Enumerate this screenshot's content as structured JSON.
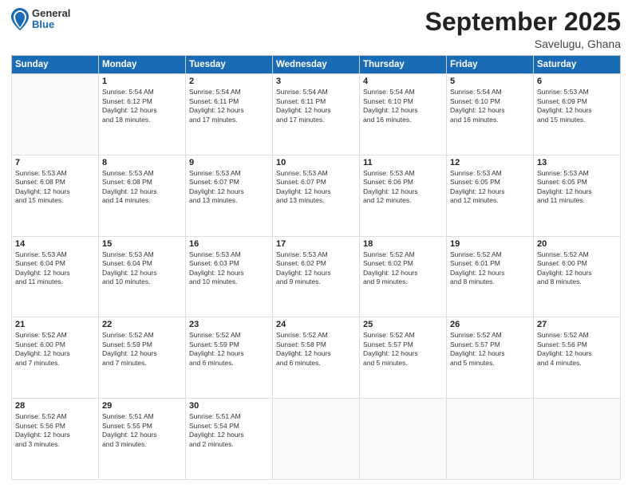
{
  "header": {
    "logo_general": "General",
    "logo_blue": "Blue",
    "month_title": "September 2025",
    "location": "Savelugu, Ghana"
  },
  "weekdays": [
    "Sunday",
    "Monday",
    "Tuesday",
    "Wednesday",
    "Thursday",
    "Friday",
    "Saturday"
  ],
  "weeks": [
    [
      {
        "day": "",
        "info": ""
      },
      {
        "day": "1",
        "info": "Sunrise: 5:54 AM\nSunset: 6:12 PM\nDaylight: 12 hours\nand 18 minutes."
      },
      {
        "day": "2",
        "info": "Sunrise: 5:54 AM\nSunset: 6:11 PM\nDaylight: 12 hours\nand 17 minutes."
      },
      {
        "day": "3",
        "info": "Sunrise: 5:54 AM\nSunset: 6:11 PM\nDaylight: 12 hours\nand 17 minutes."
      },
      {
        "day": "4",
        "info": "Sunrise: 5:54 AM\nSunset: 6:10 PM\nDaylight: 12 hours\nand 16 minutes."
      },
      {
        "day": "5",
        "info": "Sunrise: 5:54 AM\nSunset: 6:10 PM\nDaylight: 12 hours\nand 16 minutes."
      },
      {
        "day": "6",
        "info": "Sunrise: 5:53 AM\nSunset: 6:09 PM\nDaylight: 12 hours\nand 15 minutes."
      }
    ],
    [
      {
        "day": "7",
        "info": "Sunrise: 5:53 AM\nSunset: 6:08 PM\nDaylight: 12 hours\nand 15 minutes."
      },
      {
        "day": "8",
        "info": "Sunrise: 5:53 AM\nSunset: 6:08 PM\nDaylight: 12 hours\nand 14 minutes."
      },
      {
        "day": "9",
        "info": "Sunrise: 5:53 AM\nSunset: 6:07 PM\nDaylight: 12 hours\nand 13 minutes."
      },
      {
        "day": "10",
        "info": "Sunrise: 5:53 AM\nSunset: 6:07 PM\nDaylight: 12 hours\nand 13 minutes."
      },
      {
        "day": "11",
        "info": "Sunrise: 5:53 AM\nSunset: 6:06 PM\nDaylight: 12 hours\nand 12 minutes."
      },
      {
        "day": "12",
        "info": "Sunrise: 5:53 AM\nSunset: 6:05 PM\nDaylight: 12 hours\nand 12 minutes."
      },
      {
        "day": "13",
        "info": "Sunrise: 5:53 AM\nSunset: 6:05 PM\nDaylight: 12 hours\nand 11 minutes."
      }
    ],
    [
      {
        "day": "14",
        "info": "Sunrise: 5:53 AM\nSunset: 6:04 PM\nDaylight: 12 hours\nand 11 minutes."
      },
      {
        "day": "15",
        "info": "Sunrise: 5:53 AM\nSunset: 6:04 PM\nDaylight: 12 hours\nand 10 minutes."
      },
      {
        "day": "16",
        "info": "Sunrise: 5:53 AM\nSunset: 6:03 PM\nDaylight: 12 hours\nand 10 minutes."
      },
      {
        "day": "17",
        "info": "Sunrise: 5:53 AM\nSunset: 6:02 PM\nDaylight: 12 hours\nand 9 minutes."
      },
      {
        "day": "18",
        "info": "Sunrise: 5:52 AM\nSunset: 6:02 PM\nDaylight: 12 hours\nand 9 minutes."
      },
      {
        "day": "19",
        "info": "Sunrise: 5:52 AM\nSunset: 6:01 PM\nDaylight: 12 hours\nand 8 minutes."
      },
      {
        "day": "20",
        "info": "Sunrise: 5:52 AM\nSunset: 6:00 PM\nDaylight: 12 hours\nand 8 minutes."
      }
    ],
    [
      {
        "day": "21",
        "info": "Sunrise: 5:52 AM\nSunset: 6:00 PM\nDaylight: 12 hours\nand 7 minutes."
      },
      {
        "day": "22",
        "info": "Sunrise: 5:52 AM\nSunset: 5:59 PM\nDaylight: 12 hours\nand 7 minutes."
      },
      {
        "day": "23",
        "info": "Sunrise: 5:52 AM\nSunset: 5:59 PM\nDaylight: 12 hours\nand 6 minutes."
      },
      {
        "day": "24",
        "info": "Sunrise: 5:52 AM\nSunset: 5:58 PM\nDaylight: 12 hours\nand 6 minutes."
      },
      {
        "day": "25",
        "info": "Sunrise: 5:52 AM\nSunset: 5:57 PM\nDaylight: 12 hours\nand 5 minutes."
      },
      {
        "day": "26",
        "info": "Sunrise: 5:52 AM\nSunset: 5:57 PM\nDaylight: 12 hours\nand 5 minutes."
      },
      {
        "day": "27",
        "info": "Sunrise: 5:52 AM\nSunset: 5:56 PM\nDaylight: 12 hours\nand 4 minutes."
      }
    ],
    [
      {
        "day": "28",
        "info": "Sunrise: 5:52 AM\nSunset: 5:56 PM\nDaylight: 12 hours\nand 3 minutes."
      },
      {
        "day": "29",
        "info": "Sunrise: 5:51 AM\nSunset: 5:55 PM\nDaylight: 12 hours\nand 3 minutes."
      },
      {
        "day": "30",
        "info": "Sunrise: 5:51 AM\nSunset: 5:54 PM\nDaylight: 12 hours\nand 2 minutes."
      },
      {
        "day": "",
        "info": ""
      },
      {
        "day": "",
        "info": ""
      },
      {
        "day": "",
        "info": ""
      },
      {
        "day": "",
        "info": ""
      }
    ]
  ]
}
